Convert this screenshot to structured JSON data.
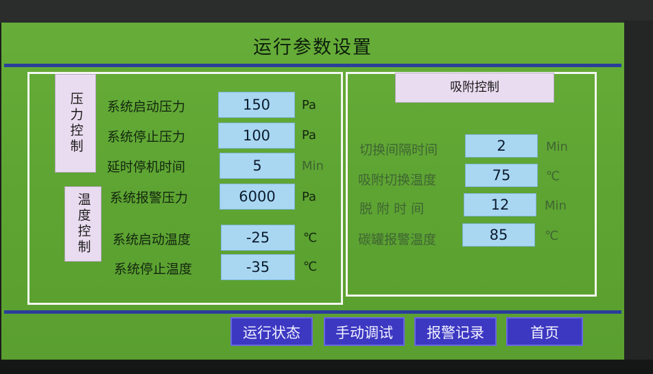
{
  "title": "运行参数设置",
  "pressure_label": "压力控制",
  "temp_label": "温度控制",
  "left_rows": [
    {
      "label": "系统启动压力",
      "value": "150",
      "unit": "Pa"
    },
    {
      "label": "系统停止压力",
      "value": "100",
      "unit": "Pa"
    },
    {
      "label": "延时停机时间",
      "value": "5",
      "unit": "Min"
    },
    {
      "label": "系统报警压力",
      "value": "6000",
      "unit": "Pa"
    },
    {
      "label": "系统启动温度",
      "value": "-25",
      "unit": "℃"
    },
    {
      "label": "系统停止温度",
      "value": "-35",
      "unit": "℃"
    }
  ],
  "right_header": "吸附控制",
  "right_rows": [
    {
      "label": "切换间隔时间",
      "value": "2",
      "unit": "Min"
    },
    {
      "label": "吸附切换温度",
      "value": "75",
      "unit": "℃"
    },
    {
      "label": "脱 附 时 间",
      "value": "12",
      "unit": "Min"
    },
    {
      "label": "碳罐报警温度",
      "value": "85",
      "unit": "℃"
    }
  ],
  "nav": [
    "运行状态",
    "手动调试",
    "报警记录",
    "首页"
  ],
  "colors": {
    "screen": "#5ea533",
    "field": "#a9d7f2",
    "button": "#3c38c2",
    "label_box": "#eadcf0",
    "rule": "#2b3e9a"
  }
}
